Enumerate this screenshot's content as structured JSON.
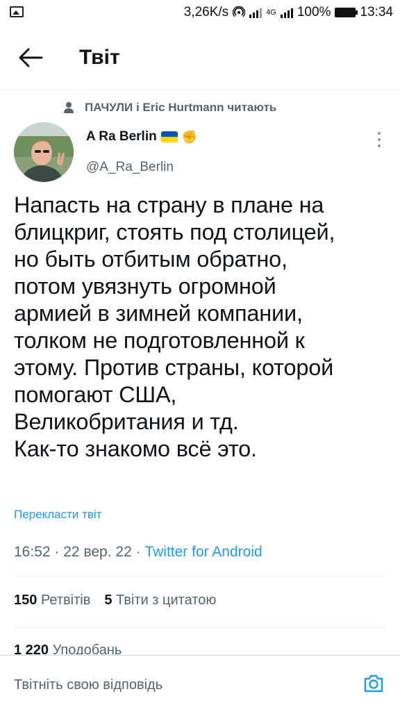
{
  "status_bar": {
    "speed": "3,26K/s",
    "net_label": "4G",
    "battery": "100%",
    "time": "13:34"
  },
  "header": {
    "title": "Твіт"
  },
  "social_context": "ПАЧУЛИ і Eric Hurtmann читають",
  "author": {
    "name": "A Ra Berlin",
    "handle": "@A_Ra_Berlin",
    "flag_colors": [
      "#0057b7",
      "#ffd700"
    ]
  },
  "tweet": {
    "text": "Напасть на страну в плане на\nблицкриг, стоять под столицей,\nно быть отбитым обратно,\nпотом увязнуть огромной\nармией в зимней компании,\nтолком не подготовленной к\nэтому. Против страны, которой\nпомогают США,\nВеликобритания и тд.\nКак-то знакомо всё это.",
    "translate_label": "Перекласти твіт",
    "time": "16:52",
    "date": "22 вер. 22",
    "separator": "·",
    "source": "Twitter for Android"
  },
  "stats": {
    "retweets_count": "150",
    "retweets_label": "Ретвітів",
    "quotes_count": "5",
    "quotes_label": "Твіти з цитатою",
    "likes_count": "1 220",
    "likes_label": "Уподобань"
  },
  "reply": {
    "placeholder": "Твітніть свою відповідь"
  },
  "colors": {
    "accent": "#1d9bf0",
    "text": "#0f1419",
    "secondary": "#536471"
  }
}
